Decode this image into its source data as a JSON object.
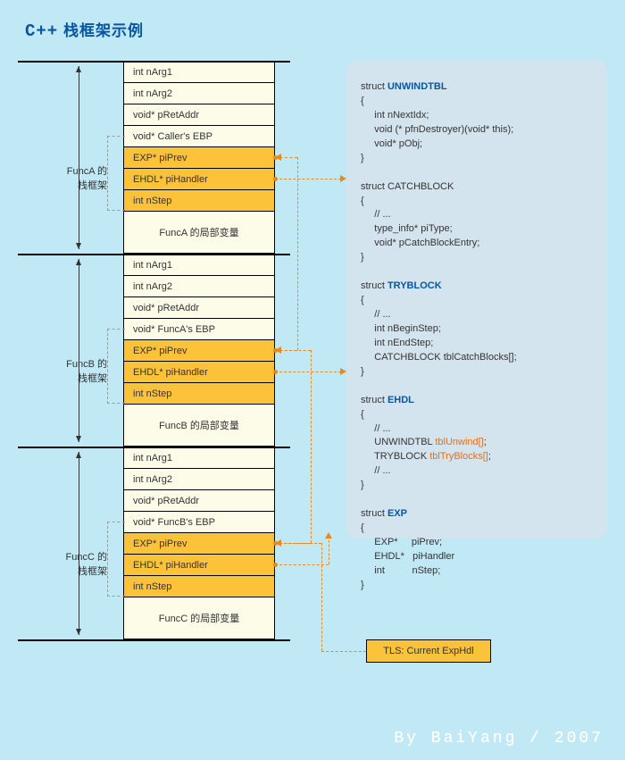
{
  "title_prefix": "C++",
  "title_rest": " 栈框架示例",
  "frames": [
    {
      "label_line1": "FuncA 的",
      "label_line2": "栈框架",
      "cells": [
        {
          "text": "int nArg1",
          "style": ""
        },
        {
          "text": "int nArg2",
          "style": ""
        },
        {
          "text": "void* pRetAddr",
          "style": ""
        },
        {
          "text": "void* Caller's EBP",
          "style": ""
        },
        {
          "text": "EXP* piPrev",
          "style": "yellow"
        },
        {
          "text": "EHDL* piHandler",
          "style": "yellow"
        },
        {
          "text": "int nStep",
          "style": "yellow"
        },
        {
          "text": "FuncA 的局部变量",
          "style": "tall center"
        }
      ]
    },
    {
      "label_line1": "FuncB 的",
      "label_line2": "栈框架",
      "cells": [
        {
          "text": "int nArg1",
          "style": ""
        },
        {
          "text": "int nArg2",
          "style": ""
        },
        {
          "text": "void* pRetAddr",
          "style": ""
        },
        {
          "text": "void* FuncA's EBP",
          "style": ""
        },
        {
          "text": "EXP* piPrev",
          "style": "yellow"
        },
        {
          "text": "EHDL* piHandler",
          "style": "yellow"
        },
        {
          "text": "int nStep",
          "style": "yellow"
        },
        {
          "text": "FuncB 的局部变量",
          "style": "tall center"
        }
      ]
    },
    {
      "label_line1": "FuncC 的",
      "label_line2": "栈框架",
      "cells": [
        {
          "text": "int nArg1",
          "style": ""
        },
        {
          "text": "int nArg2",
          "style": ""
        },
        {
          "text": "void* pRetAddr",
          "style": ""
        },
        {
          "text": "void* FuncB's EBP",
          "style": ""
        },
        {
          "text": "EXP* piPrev",
          "style": "yellow"
        },
        {
          "text": "EHDL* piHandler",
          "style": "yellow"
        },
        {
          "text": "int nStep",
          "style": "yellow"
        },
        {
          "text": "FuncC 的局部变量",
          "style": "tall center"
        }
      ]
    }
  ],
  "code": {
    "struct1_kw": "struct ",
    "struct1_name": "UNWINDTBL",
    "struct1_body": "\n{\n     int nNextIdx;\n     void (* pfnDestroyer)(void* this);\n     void* pObj;\n}\n\n",
    "struct2_kw": "struct CATCHBLOCK",
    "struct2_body": "\n{\n     // ...\n     type_info* piType;\n     void* pCatchBlockEntry;\n}\n\n",
    "struct3_kw": "struct ",
    "struct3_name": "TRYBLOCK",
    "struct3_body": "\n{\n     // ...\n     int nBeginStep;\n     int nEndStep;\n     CATCHBLOCK tblCatchBlocks[];\n}\n\n",
    "struct4_kw": "struct ",
    "struct4_name": "EHDL",
    "struct4_body1": "\n{\n     // ...\n     UNWINDTBL ",
    "struct4_orange1": "tblUnwind[]",
    "struct4_body2": ";\n     TRYBLOCK ",
    "struct4_orange2": "tblTryBlocks[]",
    "struct4_body3": ";\n     // ...\n}\n\n",
    "struct5_kw": "struct ",
    "struct5_name": "EXP",
    "struct5_body": "\n{\n     EXP*     piPrev;\n     EHDL*   piHandler\n     int          nStep;\n}"
  },
  "tls_label": "TLS: Current ExpHdl",
  "footer": "By BaiYang / 2007"
}
